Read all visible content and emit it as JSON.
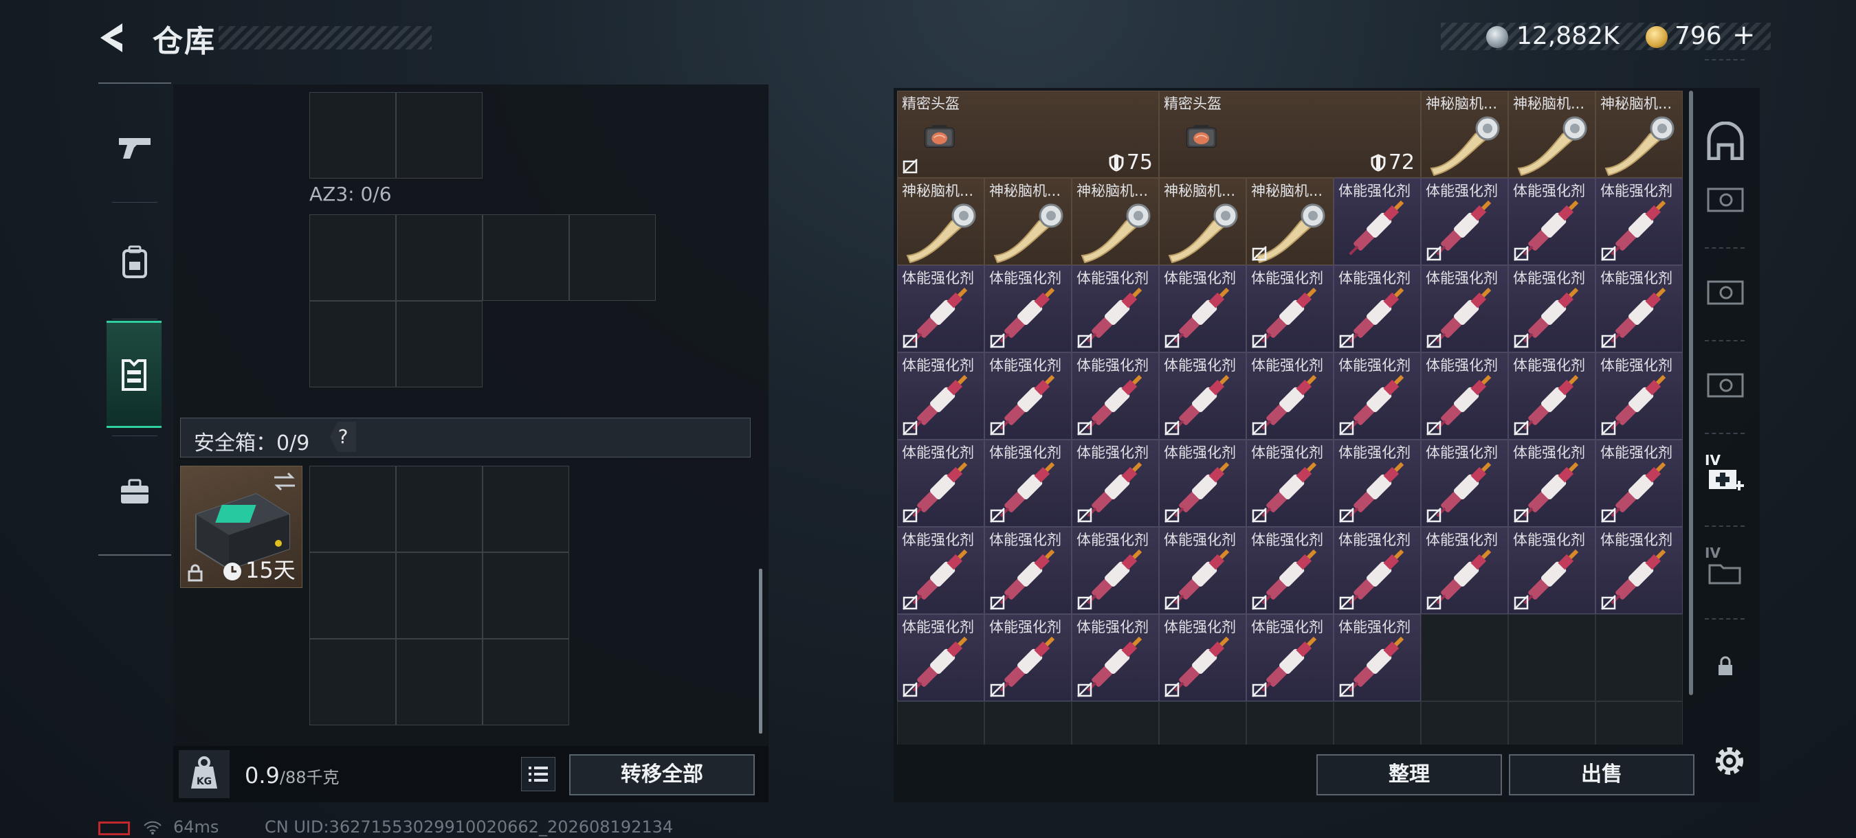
{
  "header": {
    "title": "仓库",
    "currency": {
      "silver_amount": "12,882K",
      "gold_amount": "796",
      "plus_label": "+"
    }
  },
  "left_panel": {
    "az3_label": "AZ3: 0/6",
    "safe_box": {
      "label": "安全箱：0/9",
      "help_label": "?",
      "duration": "15天"
    },
    "weight": {
      "current": "0.9",
      "max": "/88千克"
    },
    "transfer_all_label": "转移全部"
  },
  "right_panel": {
    "sort_label": "整理",
    "sell_label": "出售",
    "items": [
      {
        "name": "精密头盔",
        "kind": "helmet-bag",
        "durability": "75",
        "locked": true
      },
      {
        "name": "精密头盔",
        "kind": "helmet-bag",
        "durability": "72",
        "locked": false
      },
      {
        "name": "神秘脑机...",
        "kind": "brain-chip",
        "locked": false
      },
      {
        "name": "神秘脑机...",
        "kind": "brain-chip",
        "locked": false
      },
      {
        "name": "神秘脑机...",
        "kind": "brain-chip",
        "locked": false
      },
      {
        "name": "神秘脑机...",
        "kind": "brain-chip",
        "locked": false
      },
      {
        "name": "神秘脑机...",
        "kind": "brain-chip",
        "locked": false
      },
      {
        "name": "神秘脑机...",
        "kind": "brain-chip",
        "locked": false
      },
      {
        "name": "神秘脑机...",
        "kind": "brain-chip",
        "locked": false
      },
      {
        "name": "神秘脑机...",
        "kind": "brain-chip",
        "locked": true
      },
      {
        "name": "体能强化剂",
        "kind": "syringe",
        "locked": false
      },
      {
        "name": "体能强化剂",
        "kind": "syringe",
        "locked": true
      },
      {
        "name": "体能强化剂",
        "kind": "syringe",
        "locked": true
      },
      {
        "name": "体能强化剂",
        "kind": "syringe",
        "locked": true
      },
      {
        "name": "体能强化剂",
        "kind": "syringe",
        "locked": true
      },
      {
        "name": "体能强化剂",
        "kind": "syringe",
        "locked": true
      },
      {
        "name": "体能强化剂",
        "kind": "syringe",
        "locked": true
      },
      {
        "name": "体能强化剂",
        "kind": "syringe",
        "locked": true
      },
      {
        "name": "体能强化剂",
        "kind": "syringe",
        "locked": true
      },
      {
        "name": "体能强化剂",
        "kind": "syringe",
        "locked": true
      },
      {
        "name": "体能强化剂",
        "kind": "syringe",
        "locked": true
      },
      {
        "name": "体能强化剂",
        "kind": "syringe",
        "locked": true
      },
      {
        "name": "体能强化剂",
        "kind": "syringe",
        "locked": true
      },
      {
        "name": "体能强化剂",
        "kind": "syringe",
        "locked": true
      },
      {
        "name": "体能强化剂",
        "kind": "syringe",
        "locked": true
      },
      {
        "name": "体能强化剂",
        "kind": "syringe",
        "locked": true
      },
      {
        "name": "体能强化剂",
        "kind": "syringe",
        "locked": true
      },
      {
        "name": "体能强化剂",
        "kind": "syringe",
        "locked": true
      },
      {
        "name": "体能强化剂",
        "kind": "syringe",
        "locked": true
      },
      {
        "name": "体能强化剂",
        "kind": "syringe",
        "locked": true
      },
      {
        "name": "体能强化剂",
        "kind": "syringe",
        "locked": true
      },
      {
        "name": "体能强化剂",
        "kind": "syringe",
        "locked": true
      },
      {
        "name": "体能强化剂",
        "kind": "syringe",
        "locked": true
      },
      {
        "name": "体能强化剂",
        "kind": "syringe",
        "locked": true
      },
      {
        "name": "体能强化剂",
        "kind": "syringe",
        "locked": true
      },
      {
        "name": "体能强化剂",
        "kind": "syringe",
        "locked": true
      },
      {
        "name": "体能强化剂",
        "kind": "syringe",
        "locked": true
      },
      {
        "name": "体能强化剂",
        "kind": "syringe",
        "locked": true
      },
      {
        "name": "体能强化剂",
        "kind": "syringe",
        "locked": true
      },
      {
        "name": "体能强化剂",
        "kind": "syringe",
        "locked": true
      },
      {
        "name": "体能强化剂",
        "kind": "syringe",
        "locked": true
      },
      {
        "name": "体能强化剂",
        "kind": "syringe",
        "locked": true
      },
      {
        "name": "体能强化剂",
        "kind": "syringe",
        "locked": true
      },
      {
        "name": "体能强化剂",
        "kind": "syringe",
        "locked": true
      },
      {
        "name": "体能强化剂",
        "kind": "syringe",
        "locked": true
      },
      {
        "name": "体能强化剂",
        "kind": "syringe",
        "locked": true
      },
      {
        "name": "体能强化剂",
        "kind": "syringe",
        "locked": true
      },
      {
        "name": "体能强化剂",
        "kind": "syringe",
        "locked": true
      },
      {
        "name": "体能强化剂",
        "kind": "syringe",
        "locked": true
      },
      {
        "name": "体能强化剂",
        "kind": "syringe",
        "locked": true
      },
      {
        "name": "体能强化剂",
        "kind": "syringe",
        "locked": true
      },
      {
        "name": "体能强化剂",
        "kind": "syringe",
        "locked": true
      },
      {
        "name": "体能强化剂",
        "kind": "syringe",
        "locked": true
      },
      {
        "name": "体能强化剂",
        "kind": "syringe",
        "locked": true
      },
      {
        "name": "体能强化剂",
        "kind": "syringe",
        "locked": true
      },
      {
        "name": "体能强化剂",
        "kind": "syringe",
        "locked": true
      }
    ]
  },
  "sidebar_left": {
    "tabs": [
      "pistol-icon",
      "backpack-icon",
      "vest-icon",
      "briefcase-icon"
    ],
    "active_tab": 2
  },
  "sidebar_right": {
    "tabs": [
      "armor-icon",
      "cash-box-icon",
      "cash-box-icon",
      "cash-box-icon",
      "medkit-icon",
      "folder-icon",
      "lock-icon"
    ],
    "tier_labels": [
      "IV",
      "IV"
    ]
  },
  "status": {
    "ping": "64ms",
    "uid": "CN UID:3627155302991002066​2_202608192134"
  },
  "colors": {
    "accent": "#2fd0a0",
    "item_brown": "#4a3a2e",
    "item_purple": "#3a3550",
    "battery_red": "#c0282e"
  }
}
